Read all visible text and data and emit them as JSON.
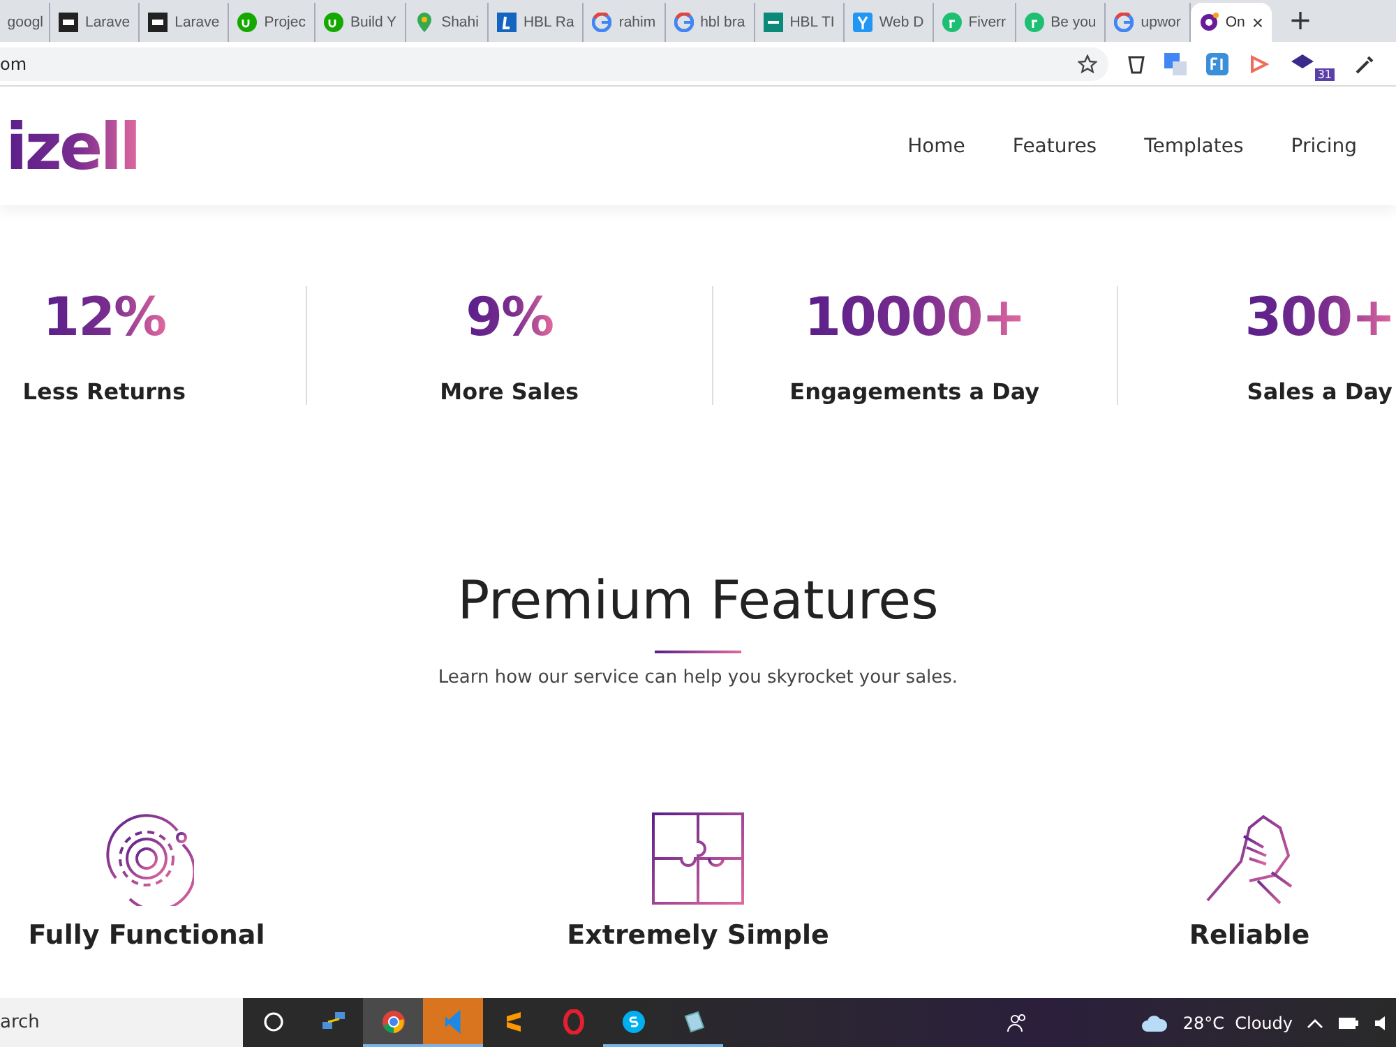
{
  "tabs": [
    {
      "title": "googl",
      "selected": false
    },
    {
      "title": "Larave",
      "kind": "ns",
      "selected": false
    },
    {
      "title": "Larave",
      "kind": "ns",
      "selected": false
    },
    {
      "title": "Projec",
      "kind": "upwork",
      "selected": false
    },
    {
      "title": "Build Y",
      "kind": "upwork",
      "selected": false
    },
    {
      "title": "Shahi",
      "kind": "maps",
      "selected": false
    },
    {
      "title": "HBL Ra",
      "kind": "blue",
      "selected": false
    },
    {
      "title": "rahim",
      "kind": "google",
      "selected": false
    },
    {
      "title": "hbl bra",
      "kind": "google",
      "selected": false
    },
    {
      "title": "HBL TI",
      "kind": "teal",
      "selected": false
    },
    {
      "title": "Web D",
      "kind": "yahoo",
      "selected": false
    },
    {
      "title": "Fiverr",
      "kind": "fiverr",
      "selected": false
    },
    {
      "title": "Be you",
      "kind": "fiverr",
      "selected": false
    },
    {
      "title": "upwor",
      "kind": "google",
      "selected": false
    },
    {
      "title": "On",
      "kind": "site",
      "selected": true
    }
  ],
  "new_tab": "+",
  "close_tab": "×",
  "address": "om",
  "extension_badge": "31",
  "site": {
    "logo": "izell",
    "nav": [
      "Home",
      "Features",
      "Templates",
      "Pricing"
    ]
  },
  "stats": [
    {
      "value": "12%",
      "label": "Less Returns"
    },
    {
      "value": "9%",
      "label": "More Sales"
    },
    {
      "value": "10000+",
      "label": "Engagements a Day"
    },
    {
      "value": "300+",
      "label": "Sales a Day"
    }
  ],
  "section": {
    "title": "Premium Features",
    "subtitle": "Learn how our service can help you skyrocket your sales."
  },
  "features": [
    {
      "title": "Fully Functional",
      "kind": "gear"
    },
    {
      "title": "Extremely Simple",
      "kind": "puzzle"
    },
    {
      "title": "Reliable",
      "kind": "handshake"
    }
  ],
  "taskbar": {
    "search": "arch",
    "apps": [
      {
        "kind": "circle",
        "selected": false
      },
      {
        "kind": "network",
        "selected": false
      },
      {
        "kind": "chrome",
        "selected": true
      },
      {
        "kind": "vscode",
        "selected": true
      },
      {
        "kind": "sublime",
        "selected": false
      },
      {
        "kind": "opera",
        "selected": false
      },
      {
        "kind": "skype",
        "selected": true
      },
      {
        "kind": "notes",
        "selected": true
      }
    ],
    "weather": "28°C  Cloudy"
  }
}
